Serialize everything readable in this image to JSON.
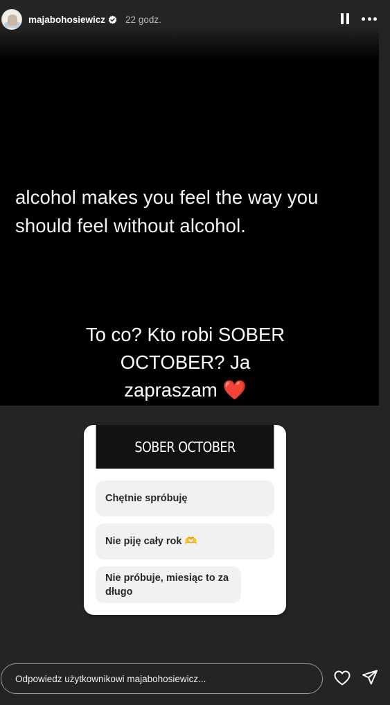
{
  "header": {
    "username": "majabohosiewicz",
    "timestamp": "22 godz.",
    "icons": [
      "avatar",
      "verified-icon",
      "pause-icon",
      "more-icon"
    ]
  },
  "story": {
    "quote": "alcohol makes you feel the way you should feel without alcohol.",
    "caption": "To co? Kto robi SOBER OCTOBER? Ja zapraszam",
    "caption_emoji": "❤️"
  },
  "poll": {
    "title": "SOBER OCTOBER",
    "options": [
      {
        "label": "Chętnie spróbuję",
        "emoji": ""
      },
      {
        "label": "Nie piję cały rok",
        "emoji": "🫶"
      },
      {
        "label": "Nie próbuje, miesiąc to za długo",
        "emoji": ""
      }
    ]
  },
  "reply": {
    "placeholder": "Odpowiedz użytkownikowi majabohosiewicz..."
  },
  "colors": {
    "background": "#242424",
    "panel": "#000000",
    "poll_header": "#101214",
    "poll_option": "#f1f1f2",
    "heart": "#e0202c"
  }
}
